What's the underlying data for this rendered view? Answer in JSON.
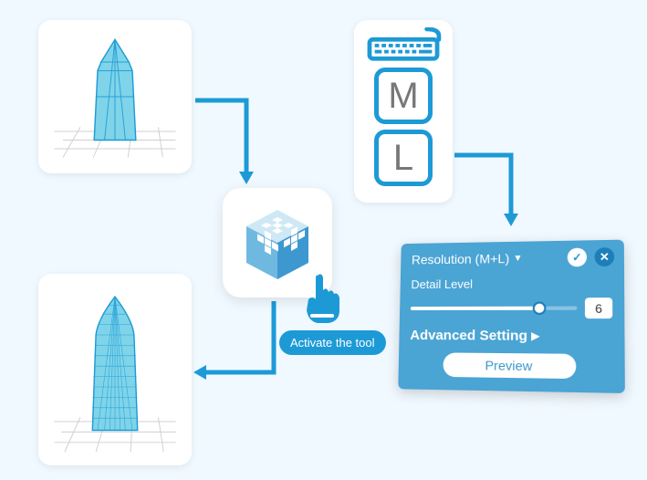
{
  "diagram": {
    "step1_label": "low-poly-model",
    "step2_label": "high-poly-model",
    "tool_label": "resolution-tool",
    "tooltip": "Activate the tool",
    "keys": {
      "key1": "M",
      "key2": "L"
    }
  },
  "panel": {
    "title": "Resolution (M+L)",
    "detail_label": "Detail Level",
    "detail_value": "6",
    "advanced_label": "Advanced Setting",
    "preview_label": "Preview"
  },
  "icons": {
    "triangle_down": "▼",
    "triangle_right": "▶",
    "check": "✓",
    "close": "✕"
  }
}
